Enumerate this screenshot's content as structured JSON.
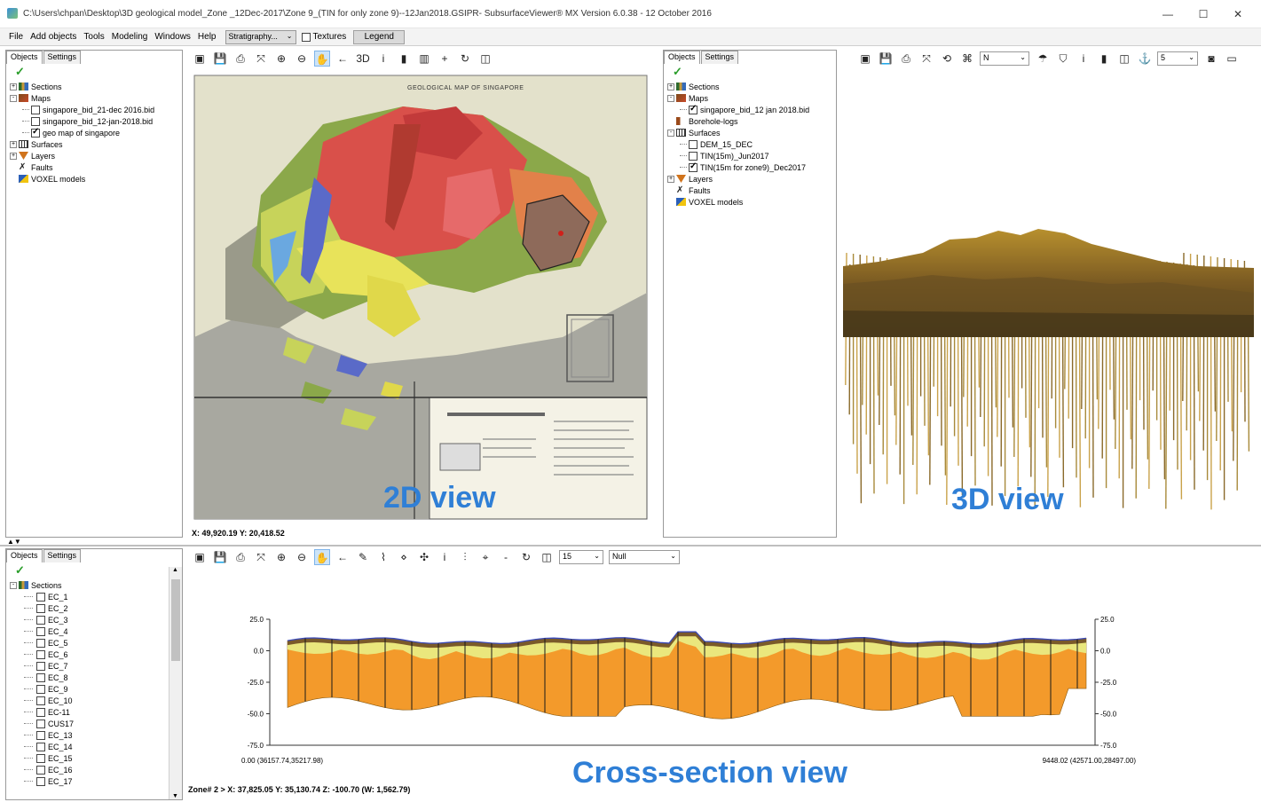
{
  "window": {
    "title": "C:\\Users\\chpan\\Desktop\\3D geological model_Zone _12Dec-2017\\Zone 9_(TIN for only zone 9)--12Jan2018.GSIPR- SubsurfaceViewer® MX Version 6.0.38 - 12 October 2016",
    "minimize": "—",
    "maximize": "☐",
    "close": "✕"
  },
  "menu": {
    "items": [
      "File",
      "Add objects",
      "Tools",
      "Modeling",
      "Windows",
      "Help"
    ],
    "stratigraphy": "Stratigraphy...",
    "textures": "Textures",
    "legend": "Legend"
  },
  "panel2d": {
    "tabs": [
      "Objects",
      "Settings"
    ],
    "tree": [
      {
        "label": "Sections",
        "icon": "sections-icon",
        "level": 0,
        "expand": "+"
      },
      {
        "label": "Maps",
        "icon": "maps-icon",
        "level": 0,
        "expand": "-"
      },
      {
        "label": "singapore_bid_21-dec 2016.bid",
        "level": 1,
        "checked": false
      },
      {
        "label": "singapore_bid_12-jan-2018.bid",
        "level": 1,
        "checked": false
      },
      {
        "label": "geo map of singapore",
        "level": 1,
        "checked": true
      },
      {
        "label": "Surfaces",
        "icon": "surfaces-icon",
        "level": 0,
        "expand": "+"
      },
      {
        "label": "Layers",
        "icon": "layers-icon",
        "level": 0,
        "expand": "+"
      },
      {
        "label": "Faults",
        "icon": "faults-icon",
        "level": 0
      },
      {
        "label": "VOXEL models",
        "icon": "voxel-icon",
        "level": 0
      }
    ],
    "map_title": "GEOLOGICAL MAP OF SINGAPORE",
    "coords": "X: 49,920.19 Y: 20,418.52",
    "view_label": "2D view"
  },
  "panel3d": {
    "tabs": [
      "Objects",
      "Settings"
    ],
    "tree": [
      {
        "label": "Sections",
        "icon": "sections-icon",
        "level": 0,
        "expand": "+"
      },
      {
        "label": "Maps",
        "icon": "maps-icon",
        "level": 0,
        "expand": "-"
      },
      {
        "label": "singapore_bid_12 jan 2018.bid",
        "level": 1,
        "checked": true
      },
      {
        "label": "Borehole-logs",
        "icon": "borehole-icon",
        "level": 0
      },
      {
        "label": "Surfaces",
        "icon": "surfaces-icon",
        "level": 0,
        "expand": "-"
      },
      {
        "label": "DEM_15_DEC",
        "level": 1,
        "checked": false
      },
      {
        "label": "TIN(15m)_Jun2017",
        "level": 1,
        "checked": false
      },
      {
        "label": "TIN(15m for zone9)_Dec2017",
        "level": 1,
        "checked": true
      },
      {
        "label": "Layers",
        "icon": "layers-icon",
        "level": 0,
        "expand": "+"
      },
      {
        "label": "Faults",
        "icon": "faults-icon",
        "level": 0
      },
      {
        "label": "VOXEL models",
        "icon": "voxel-icon",
        "level": 0
      }
    ],
    "direction": "N",
    "number": "5",
    "view_label": "3D view"
  },
  "panelxs": {
    "tabs": [
      "Objects",
      "Settings"
    ],
    "tree_root": "Sections",
    "sections": [
      "EC_1",
      "EC_2",
      "EC_3",
      "EC_4",
      "EC_5",
      "EC_6",
      "EC_7",
      "EC_8",
      "EC_9",
      "EC_10",
      "EC-11",
      "CUS17",
      "EC_13",
      "EC_14",
      "EC_15",
      "EC_16",
      "EC_17"
    ],
    "zoom": "15",
    "null_option": "Null",
    "status": "Zone# 2    >  X: 37,825.05 Y: 35,130.74 Z: -100.70 (W: 1,562.79)",
    "view_label": "Cross-section view"
  },
  "chart_data": {
    "type": "area",
    "left_ticks": [
      "25.0",
      "0.0",
      "-25.0",
      "-50.0",
      "-75.0"
    ],
    "right_ticks": [
      "25.0",
      "0.0",
      "-25.0",
      "-50.0",
      "-75.0"
    ],
    "ylim": [
      -75,
      25
    ],
    "x_start_label": "0.00  (36157.74,35217.98)",
    "x_end_label": "9448.02  (42571.00,28497.00)"
  },
  "colors": {
    "accent_label": "#2f7fd6",
    "clay": "#f39a2b",
    "topsoil": "#7a5a2a",
    "yellow_layer": "#e9ef86"
  }
}
